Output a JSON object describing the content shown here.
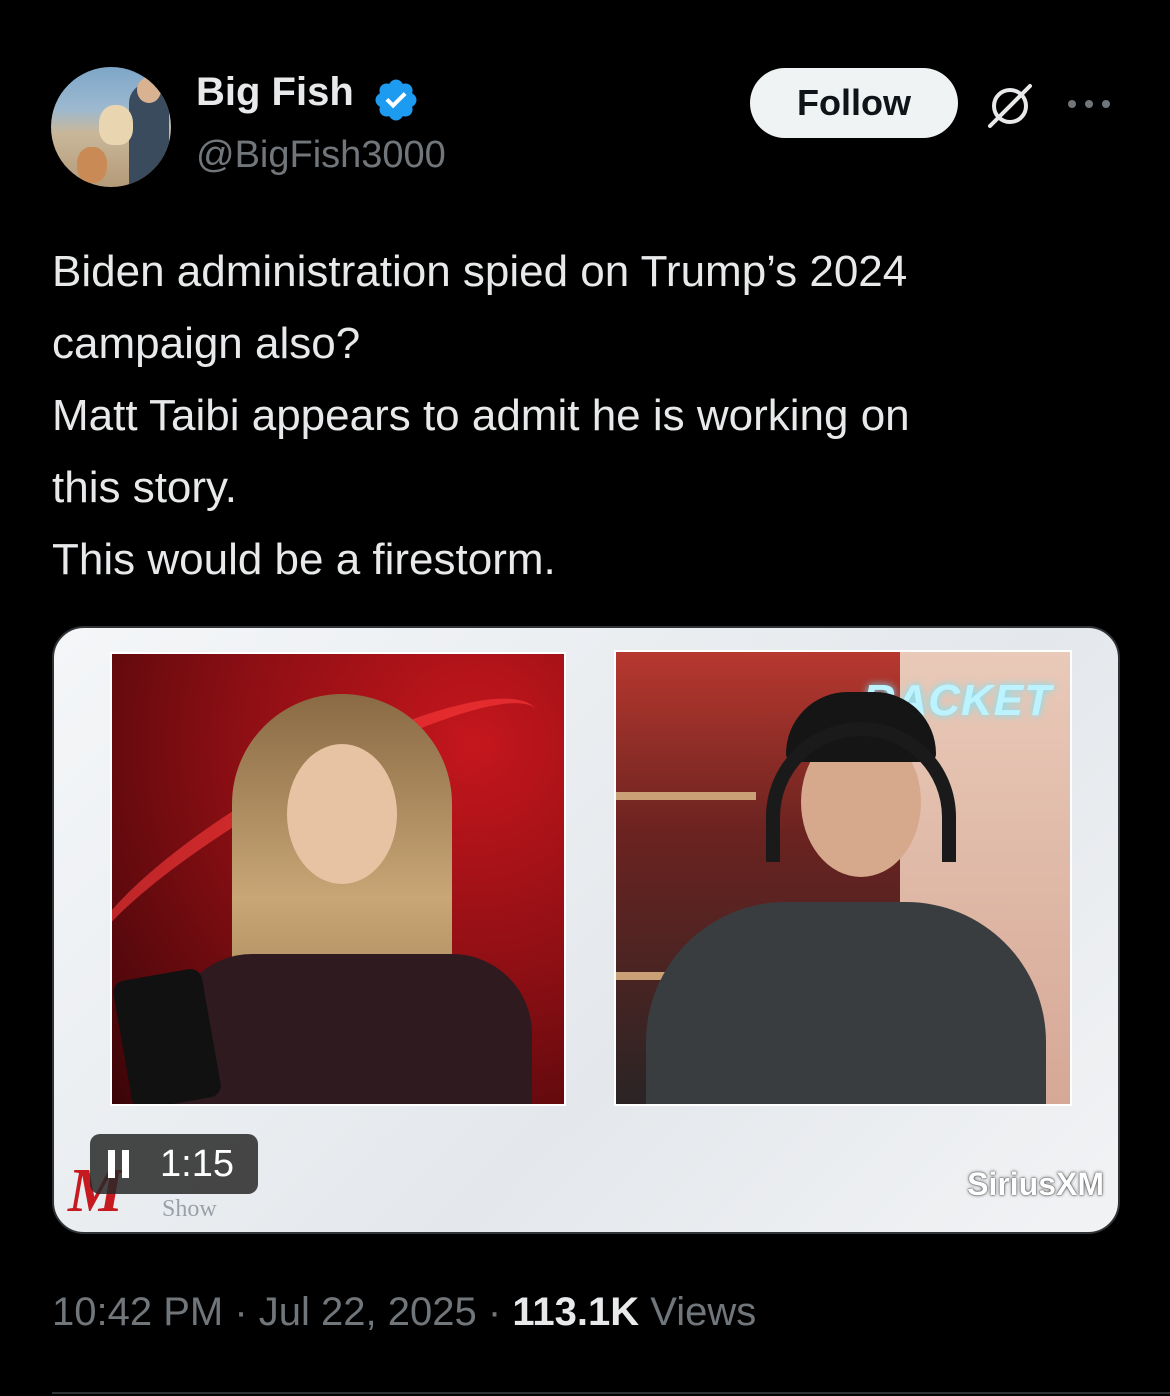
{
  "author": {
    "name": "Big Fish",
    "handle": "@BigFish3000",
    "verified": true,
    "verified_color": "#1d9bf0"
  },
  "actions": {
    "follow_label": "Follow",
    "grok_icon": "grok-icon",
    "more_icon": "more-icon"
  },
  "tweet": {
    "lines": [
      "Biden administration spied on Trump’s 2024",
      "campaign also?",
      "Matt Taibi appears to admit he is working on",
      "this story.",
      "This would be a firestorm."
    ]
  },
  "video": {
    "time": "1:15",
    "state": "playing",
    "watermark_left_letter": "M",
    "watermark_left_word": "Show",
    "watermark_right": "SiriusXM",
    "neon_sign": "RACKET"
  },
  "meta": {
    "time": "10:42 PM",
    "sep": "·",
    "date": "Jul 22, 2025",
    "views_count": "113.1K",
    "views_label": "Views"
  },
  "colors": {
    "background": "#000000",
    "text": "#e7e9ea",
    "secondary": "#71767b",
    "button_bg": "#eff3f4"
  }
}
